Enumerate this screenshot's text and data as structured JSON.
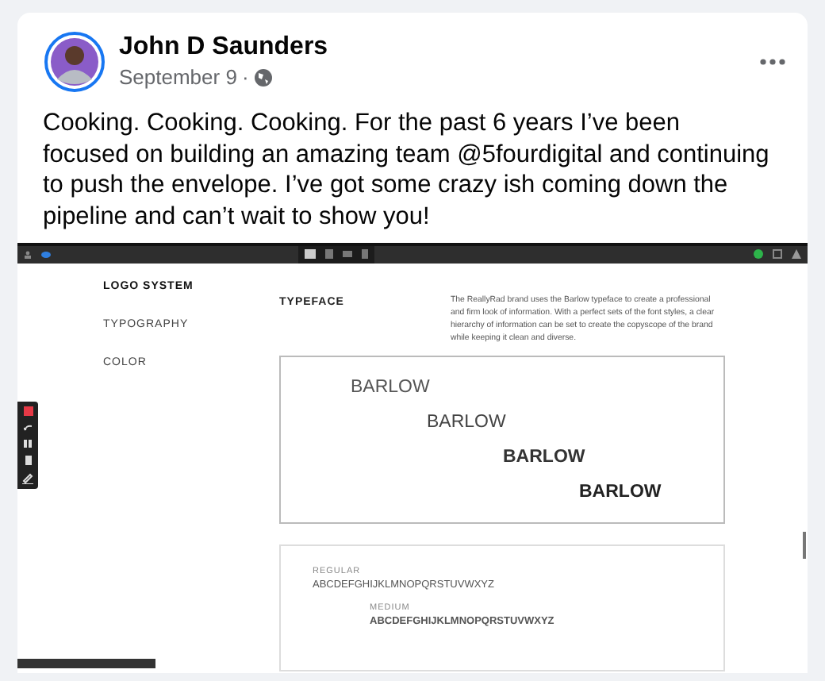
{
  "post": {
    "author": "John D Saunders",
    "date": "September 9",
    "separator": "·",
    "text": "Cooking. Cooking. Cooking. For the past 6 years I’ve been focused on building an amazing team @5fourdigital and continuing to push the envelope. I’ve got some crazy ish coming down the pipeline and can’t wait to show you!"
  },
  "video": {
    "nav": [
      {
        "label": "LOGO SYSTEM",
        "selected": true
      },
      {
        "label": "TYPOGRAPHY",
        "selected": false
      },
      {
        "label": "COLOR",
        "selected": false
      }
    ],
    "heading": "TYPEFACE",
    "description": "The ReallyRad brand uses the Barlow typeface to create a professional and firm look of information. With a perfect sets of the font styles, a clear hierarchy of information can be set to create the copyscope of the brand while keeping it clean and diverse.",
    "samples": [
      {
        "text": "BARLOW",
        "kind": "light"
      },
      {
        "text": "BARLOW",
        "kind": "regular"
      },
      {
        "text": "BARLOW",
        "kind": "semibold"
      },
      {
        "text": "BARLOW",
        "kind": "bold"
      }
    ],
    "weights": [
      {
        "label": "REGULAR",
        "alphabet": "ABCDEFGHIJKLMNOPQRSTUVWXYZ"
      },
      {
        "label": "MEDIUM",
        "alphabet": "ABCDEFGHIJKLMNOPQRSTUVWXYZ"
      }
    ]
  }
}
